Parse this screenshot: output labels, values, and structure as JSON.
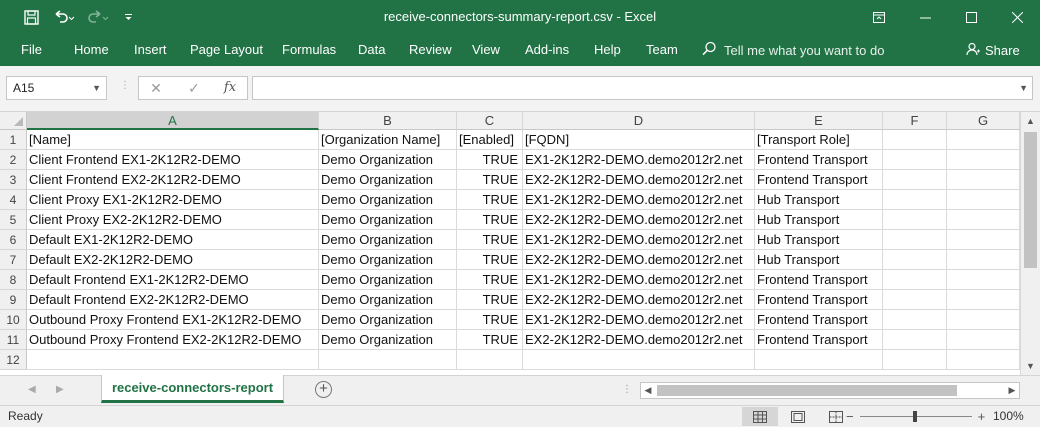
{
  "window": {
    "title": "receive-connectors-summary-report.csv",
    "app_name": "Excel",
    "title_separator": " - "
  },
  "quick_access": {
    "save_icon": "save-icon",
    "undo_icon": "undo-icon",
    "redo_icon": "redo-icon",
    "customize_icon": "customize-qat-icon"
  },
  "ribbon": {
    "tabs": [
      "File",
      "Home",
      "Insert",
      "Page Layout",
      "Formulas",
      "Data",
      "Review",
      "View",
      "Add-ins",
      "Help",
      "Team"
    ],
    "tell_me": "Tell me what you want to do",
    "share": "Share"
  },
  "formula_bar": {
    "name_box": "A15",
    "cancel_symbol": "✕",
    "enter_symbol": "✓",
    "fx_label": "fx",
    "formula": ""
  },
  "sheet": {
    "columns": [
      "A",
      "B",
      "C",
      "D",
      "E",
      "F",
      "G"
    ],
    "selected_column": "A",
    "selected_row": "15",
    "row_numbers": [
      "1",
      "2",
      "3",
      "4",
      "5",
      "6",
      "7",
      "8",
      "9",
      "10",
      "11",
      "12"
    ],
    "rows": [
      [
        "[Name]",
        "[Organization Name]",
        "[Enabled]",
        "[FQDN]",
        "[Transport Role]",
        "",
        ""
      ],
      [
        "Client Frontend EX1-2K12R2-DEMO",
        "Demo Organization",
        "TRUE",
        "EX1-2K12R2-DEMO.demo2012r2.net",
        "Frontend Transport",
        "",
        ""
      ],
      [
        "Client Frontend EX2-2K12R2-DEMO",
        "Demo Organization",
        "TRUE",
        "EX2-2K12R2-DEMO.demo2012r2.net",
        "Frontend Transport",
        "",
        ""
      ],
      [
        "Client Proxy EX1-2K12R2-DEMO",
        "Demo Organization",
        "TRUE",
        "EX1-2K12R2-DEMO.demo2012r2.net",
        "Hub Transport",
        "",
        ""
      ],
      [
        "Client Proxy EX2-2K12R2-DEMO",
        "Demo Organization",
        "TRUE",
        "EX2-2K12R2-DEMO.demo2012r2.net",
        "Hub Transport",
        "",
        ""
      ],
      [
        "Default EX1-2K12R2-DEMO",
        "Demo Organization",
        "TRUE",
        "EX1-2K12R2-DEMO.demo2012r2.net",
        "Hub Transport",
        "",
        ""
      ],
      [
        "Default EX2-2K12R2-DEMO",
        "Demo Organization",
        "TRUE",
        "EX2-2K12R2-DEMO.demo2012r2.net",
        "Hub Transport",
        "",
        ""
      ],
      [
        "Default Frontend EX1-2K12R2-DEMO",
        "Demo Organization",
        "TRUE",
        "EX1-2K12R2-DEMO.demo2012r2.net",
        "Frontend Transport",
        "",
        ""
      ],
      [
        "Default Frontend EX2-2K12R2-DEMO",
        "Demo Organization",
        "TRUE",
        "EX2-2K12R2-DEMO.demo2012r2.net",
        "Frontend Transport",
        "",
        ""
      ],
      [
        "Outbound Proxy Frontend EX1-2K12R2-DEMO",
        "Demo Organization",
        "TRUE",
        "EX1-2K12R2-DEMO.demo2012r2.net",
        "Frontend Transport",
        "",
        ""
      ],
      [
        "Outbound Proxy Frontend EX2-2K12R2-DEMO",
        "Demo Organization",
        "TRUE",
        "EX2-2K12R2-DEMO.demo2012r2.net",
        "Frontend Transport",
        "",
        ""
      ],
      [
        "",
        "",
        "",
        "",
        "",
        "",
        ""
      ]
    ]
  },
  "sheet_tabs": {
    "active": "receive-connectors-report",
    "add_icon": "add-sheet-icon"
  },
  "status_bar": {
    "status": "Ready",
    "zoom_percent": "100%",
    "zoom_level": 1.0,
    "zoom_out": "−",
    "zoom_in": "+"
  },
  "colors": {
    "accent": "#217346",
    "grid_line": "#dadada",
    "header_bg": "#f0f0f0"
  }
}
